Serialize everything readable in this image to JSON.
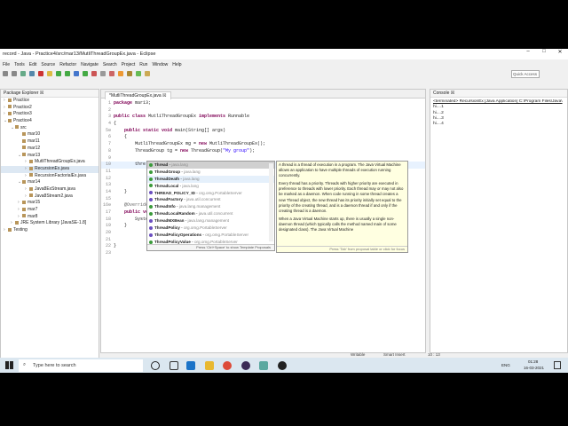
{
  "window": {
    "title": "record - Java - Practice4/src/mar13/MutliThreadGroupEx.java - Eclipse",
    "controls": [
      "–",
      "□",
      "✕"
    ]
  },
  "menu": [
    "File",
    "Tools",
    "Edit",
    "Source",
    "Refactor",
    "Navigate",
    "Search",
    "Project",
    "Run",
    "Window",
    "Help"
  ],
  "quick_access": "Quick Access",
  "package_explorer": {
    "title": "Package Explorer ☒",
    "items": [
      {
        "label": "Practice",
        "depth": 0,
        "arrow": "›"
      },
      {
        "label": "Practice2",
        "depth": 0,
        "arrow": "›"
      },
      {
        "label": "Practice3",
        "depth": 0,
        "arrow": "›"
      },
      {
        "label": "Practice4",
        "depth": 0,
        "arrow": "⌄"
      },
      {
        "label": "src",
        "depth": 1,
        "arrow": "⌄"
      },
      {
        "label": "mar10",
        "depth": 2,
        "arrow": ""
      },
      {
        "label": "mar11",
        "depth": 2,
        "arrow": ""
      },
      {
        "label": "mar12",
        "depth": 2,
        "arrow": ""
      },
      {
        "label": "mar13",
        "depth": 2,
        "arrow": "⌄"
      },
      {
        "label": "MutliThreadGroupEx.java",
        "depth": 3,
        "arrow": "›"
      },
      {
        "label": "RecursionEx.java",
        "depth": 3,
        "arrow": "›",
        "selected": true
      },
      {
        "label": "RecursionFactorialEx.java",
        "depth": 3,
        "arrow": "›"
      },
      {
        "label": "mar14",
        "depth": 2,
        "arrow": "⌄"
      },
      {
        "label": "Java8ExStream.java",
        "depth": 3,
        "arrow": "›"
      },
      {
        "label": "Java8Stream2.java",
        "depth": 3,
        "arrow": "›"
      },
      {
        "label": "mar15",
        "depth": 2,
        "arrow": "›"
      },
      {
        "label": "mar7",
        "depth": 2,
        "arrow": "›"
      },
      {
        "label": "mar8",
        "depth": 2,
        "arrow": "›"
      },
      {
        "label": "JRE System Library [JavaSE-1.8]",
        "depth": 1,
        "arrow": "›"
      },
      {
        "label": "Testing",
        "depth": 0,
        "arrow": "›"
      }
    ]
  },
  "editor": {
    "tab": "*MutliThreadGroupEx.java ☒",
    "lines": [
      {
        "n": "1",
        "html": "<span class='kw'>package</span> mar13;"
      },
      {
        "n": "2",
        "html": ""
      },
      {
        "n": "3",
        "html": "<span class='kw'>public class</span> MutliThreadGroupEx <span class='kw'>implements</span> Runnable"
      },
      {
        "n": "4",
        "html": "{"
      },
      {
        "n": "5⊖",
        "html": "    <span class='kw'>public static void</span> main(String[] args)"
      },
      {
        "n": "6",
        "html": "    {"
      },
      {
        "n": "7",
        "html": "        MutliThreadGroupEx mg = <span class='kw'>new</span> MutliThreadGroupEx();"
      },
      {
        "n": "8",
        "html": "        ThreadGroup tg = <span class='kw'>new</span> ThreadGroup(<span class='str'>\"My group\"</span>);"
      },
      {
        "n": "9",
        "html": ""
      },
      {
        "n": "10",
        "html": "        thre",
        "current": true
      },
      {
        "n": "11",
        "html": ""
      },
      {
        "n": "12",
        "html": ""
      },
      {
        "n": "13",
        "html": ""
      },
      {
        "n": "14",
        "html": "    }"
      },
      {
        "n": "15",
        "html": ""
      },
      {
        "n": "16⊖",
        "html": "    <span class='ann'>@Override</span>"
      },
      {
        "n": "17",
        "html": "    <span class='kw'>public vo</span>"
      },
      {
        "n": "18",
        "html": "        Syste"
      },
      {
        "n": "19",
        "html": "    }"
      },
      {
        "n": "20",
        "html": ""
      },
      {
        "n": "21",
        "html": ""
      },
      {
        "n": "22",
        "html": "}"
      },
      {
        "n": "23",
        "html": ""
      }
    ]
  },
  "proposals": {
    "items": [
      {
        "name": "Thread",
        "pkg": "java.lang",
        "color": "#3a9a3a",
        "selected": true
      },
      {
        "name": "ThreadGroup",
        "pkg": "java.lang",
        "color": "#3a9a3a"
      },
      {
        "name": "ThreadDeath",
        "pkg": "java.lang",
        "color": "#3a9a3a",
        "hover": true
      },
      {
        "name": "ThreadLocal",
        "pkg": "java.lang",
        "color": "#3a9a3a"
      },
      {
        "name": "THREAD_POLICY_ID",
        "pkg": "org.omg.PortableServer",
        "color": "#6a4ec0"
      },
      {
        "name": "ThreadFactory",
        "pkg": "java.util.concurrent",
        "color": "#6a4ec0"
      },
      {
        "name": "ThreadInfo",
        "pkg": "java.lang.management",
        "color": "#3a9a3a"
      },
      {
        "name": "ThreadLocalRandom",
        "pkg": "java.util.concurrent",
        "color": "#3a9a3a"
      },
      {
        "name": "ThreadMXBean",
        "pkg": "java.lang.management",
        "color": "#6a4ec0"
      },
      {
        "name": "ThreadPolicy",
        "pkg": "org.omg.PortableServer",
        "color": "#6a4ec0"
      },
      {
        "name": "ThreadPolicyOperations",
        "pkg": "org.omg.PortableServer",
        "color": "#6a4ec0"
      },
      {
        "name": "ThreadPolicyValue",
        "pkg": "org.omg.PortableServer",
        "color": "#3a9a3a"
      }
    ],
    "hint": "Press 'Ctrl+Space' to show Template Proposals"
  },
  "javadoc": {
    "paragraphs": [
      "A thread is a thread of execution in a program. The Java Virtual Machine allows an application to have multiple threads of execution running concurrently.",
      "Every thread has a priority. Threads with higher priority are executed in preference to threads with lower priority. Each thread may or may not also be marked as a daemon. When code running in some thread creates a new Thread object, the new thread has its priority initially set equal to the priority of the creating thread, and is a daemon thread if and only if the creating thread is a daemon.",
      "When a Java Virtual Machine starts up, there is usually a single non-daemon thread (which typically calls the method named main of some designated class). The Java Virtual Machine"
    ],
    "hint": "Press 'Tab' from proposal table or click for focus"
  },
  "console": {
    "title": "Console ☒",
    "header": "<terminated> RecursionEx [Java Application] C:\\Program Files\\Java\\",
    "lines": [
      "hi....1",
      "hi....2",
      "hi....3",
      "hi....4"
    ]
  },
  "status": {
    "mode": "Writable",
    "insert": "Smart Insert",
    "position": "10 : 13"
  },
  "taskbar": {
    "search_placeholder": "Type here to search",
    "time": "01:28",
    "date": "16-03-2021",
    "lang": "ENG"
  }
}
